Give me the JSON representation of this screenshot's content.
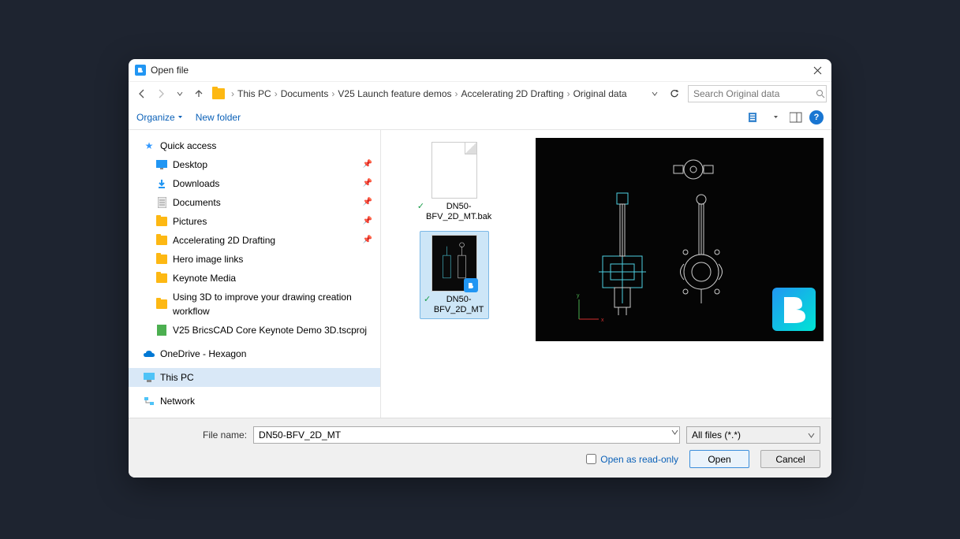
{
  "title": "Open file",
  "breadcrumbs": [
    "This PC",
    "Documents",
    "V25 Launch feature demos",
    "Accelerating 2D Drafting",
    "Original data"
  ],
  "search_placeholder": "Search Original data",
  "toolbar": {
    "organize": "Organize",
    "new_folder": "New folder"
  },
  "tree": {
    "quick_access": "Quick access",
    "items": [
      {
        "label": "Desktop",
        "pinned": true,
        "icon": "desktop"
      },
      {
        "label": "Downloads",
        "pinned": true,
        "icon": "download"
      },
      {
        "label": "Documents",
        "pinned": true,
        "icon": "doc"
      },
      {
        "label": "Pictures",
        "pinned": true,
        "icon": "pic"
      },
      {
        "label": "Accelerating 2D Drafting",
        "pinned": true,
        "icon": "folder"
      },
      {
        "label": "Hero image links",
        "pinned": false,
        "icon": "folder"
      },
      {
        "label": "Keynote Media",
        "pinned": false,
        "icon": "folder"
      },
      {
        "label": "Using 3D to improve your drawing creation workflow",
        "pinned": false,
        "icon": "folder"
      },
      {
        "label": "V25 BricsCAD Core Keynote Demo 3D.tscproj",
        "pinned": false,
        "icon": "proj"
      }
    ],
    "onedrive": "OneDrive - Hexagon",
    "this_pc": "This PC",
    "network": "Network"
  },
  "files": [
    {
      "name": "DN50-BFV_2D_MT.bak",
      "type": "bak",
      "selected": false
    },
    {
      "name": "DN50-BFV_2D_MT",
      "type": "cad",
      "selected": true
    }
  ],
  "footer": {
    "filename_label": "File name:",
    "filename_value": "DN50-BFV_2D_MT",
    "filter": "All files (*.*)",
    "readonly": "Open as read-only",
    "open": "Open",
    "cancel": "Cancel"
  }
}
